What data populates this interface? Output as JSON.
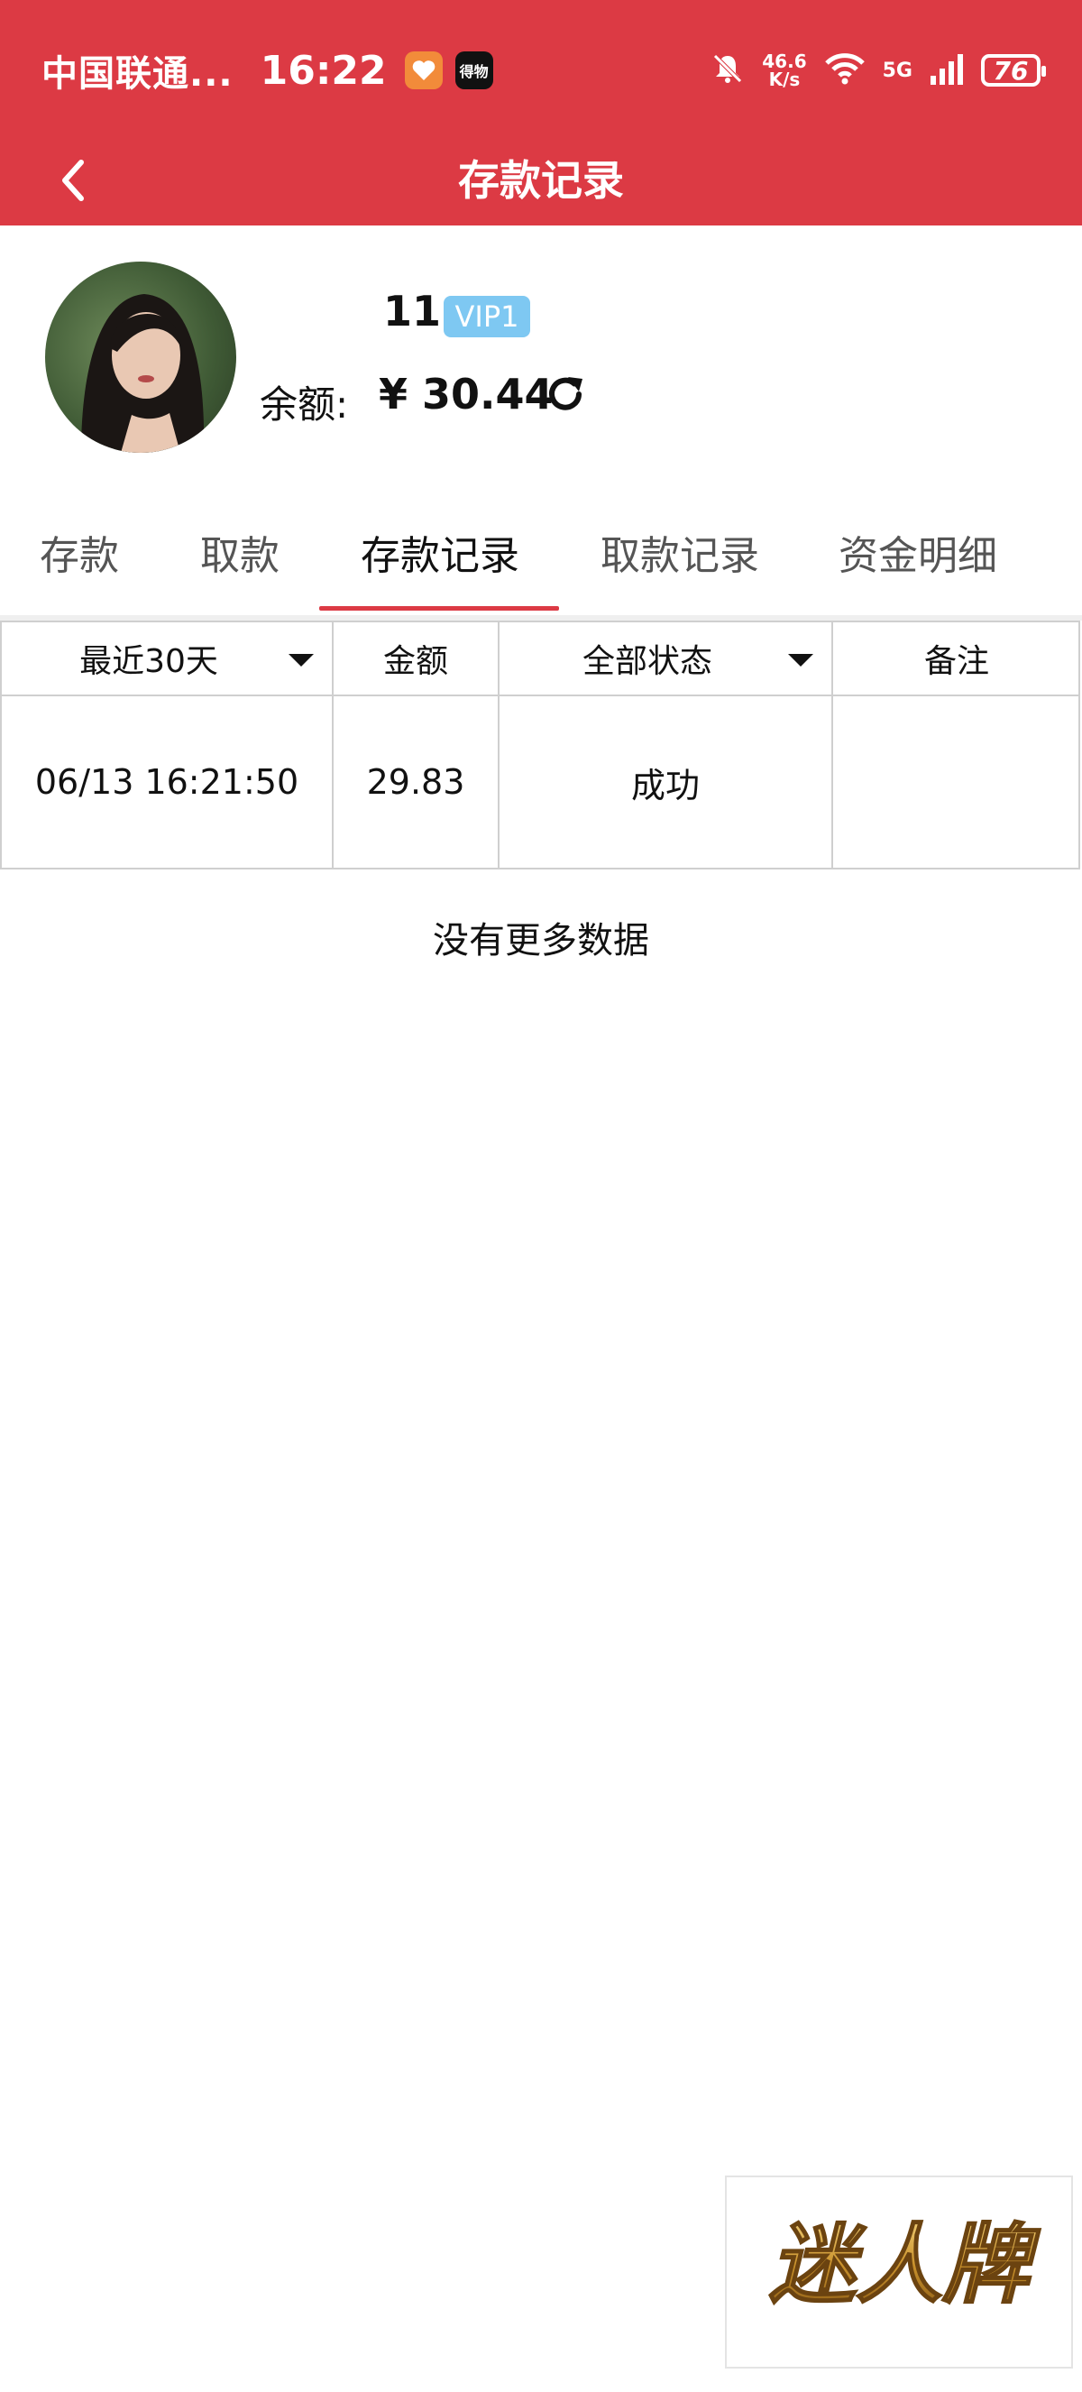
{
  "status_bar": {
    "carrier": "中国联通...",
    "time": "16:22",
    "app_badge": "得物",
    "net_speed_top": "46.6",
    "net_speed_bottom": "K/s",
    "network": "5G",
    "battery": "76"
  },
  "header": {
    "title": "存款记录"
  },
  "profile": {
    "username": "11",
    "vip_badge": "VIP1",
    "balance_label": "余额:",
    "balance_value": "¥ 30.44"
  },
  "tabs": [
    {
      "label": "存款",
      "active": false
    },
    {
      "label": "取款",
      "active": false
    },
    {
      "label": "存款记录",
      "active": true
    },
    {
      "label": "取款记录",
      "active": false
    },
    {
      "label": "资金明细",
      "active": false
    }
  ],
  "table": {
    "headers": [
      "最近30天",
      "金额",
      "全部状态",
      "备注"
    ],
    "rows": [
      {
        "time": "06/13 16:21:50",
        "amount": "29.83",
        "status": "成功",
        "note": ""
      }
    ]
  },
  "footer_text": "没有更多数据",
  "watermark_logo": "迷人牌",
  "colors": {
    "primary": "#dc3a44",
    "vip": "#7ec8f2",
    "logo_gold": "#c9912c"
  }
}
